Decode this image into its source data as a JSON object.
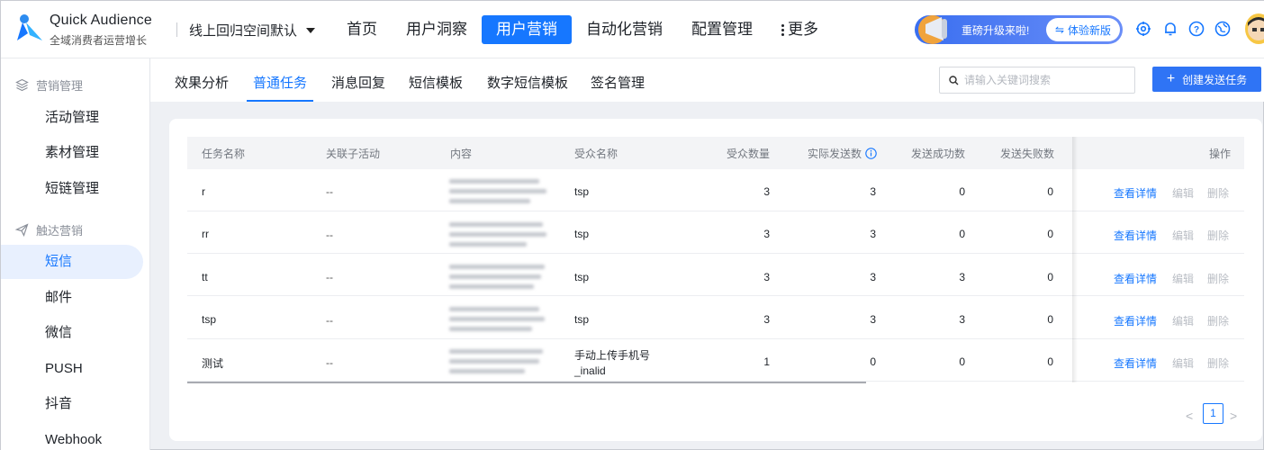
{
  "brand": {
    "title": "Quick Audience",
    "subtitle": "全域消费者运营增长"
  },
  "space_select": "线上回归空间默认",
  "top_nav": [
    "首页",
    "用户洞察",
    "用户营销",
    "自动化营销",
    "配置管理",
    "更多"
  ],
  "upgrade": {
    "text": "重磅升级来啦!",
    "button": "体验新版"
  },
  "sidebar": {
    "group1": "营销管理",
    "group1_items": [
      "活动管理",
      "素材管理",
      "短链管理"
    ],
    "group2": "触达营销",
    "group2_items": [
      "短信",
      "邮件",
      "微信",
      "PUSH",
      "抖音",
      "Webhook"
    ]
  },
  "tabs": [
    "效果分析",
    "普通任务",
    "消息回复",
    "短信模板",
    "数字短信模板",
    "签名管理"
  ],
  "search": {
    "placeholder": "请输入关键词搜索"
  },
  "create_button": "创建发送任务",
  "table": {
    "headers": [
      "任务名称",
      "关联子活动",
      "内容",
      "受众名称",
      "受众数量",
      "实际发送数",
      "发送成功数",
      "发送失败数",
      "操作"
    ],
    "rows": [
      {
        "name": "r",
        "sub": "--",
        "audience": "tsp",
        "audience2": "",
        "count": "3",
        "sent": "3",
        "success": "0",
        "failed": "0"
      },
      {
        "name": "rr",
        "sub": "--",
        "audience": "tsp",
        "audience2": "",
        "count": "3",
        "sent": "3",
        "success": "0",
        "failed": "0"
      },
      {
        "name": "tt",
        "sub": "--",
        "audience": "tsp",
        "audience2": "",
        "count": "3",
        "sent": "3",
        "success": "3",
        "failed": "0"
      },
      {
        "name": "tsp",
        "sub": "--",
        "audience": "tsp",
        "audience2": "",
        "count": "3",
        "sent": "3",
        "success": "3",
        "failed": "0"
      },
      {
        "name": "测试",
        "sub": "--",
        "audience": "手动上传手机号",
        "audience2": "_inalid",
        "count": "1",
        "sent": "0",
        "success": "0",
        "failed": "0"
      }
    ],
    "actions": {
      "view": "查看详情",
      "edit": "编辑",
      "delete": "删除"
    }
  },
  "pagination": {
    "current": "1",
    "prev": "<",
    "next": ">"
  },
  "colors": {
    "primary": "#1677ff",
    "active_bg": "#e8f0fe"
  }
}
